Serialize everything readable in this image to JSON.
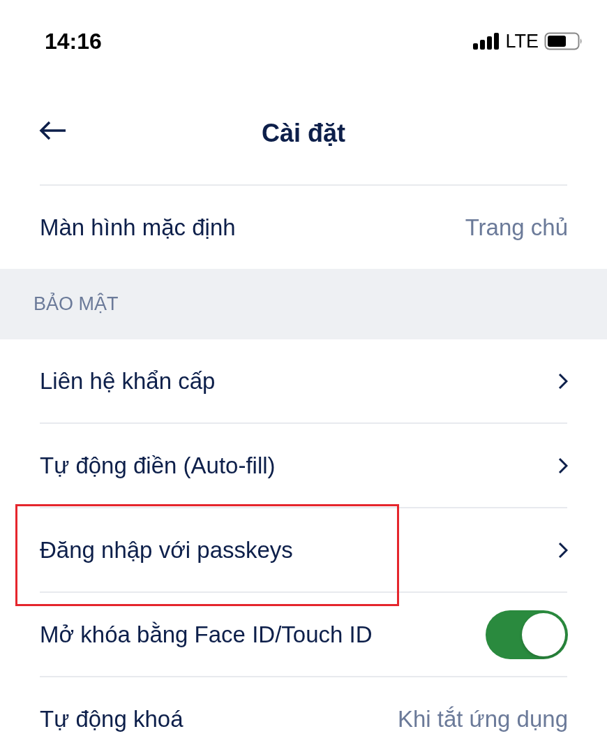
{
  "status_bar": {
    "time": "14:16",
    "network": "LTE"
  },
  "header": {
    "title": "Cài đặt"
  },
  "general_rows": [
    {
      "kind": "value",
      "label": "Màn hình mặc định",
      "value": "Trang chủ"
    }
  ],
  "section": {
    "title": "BẢO MẬT"
  },
  "security_rows": [
    {
      "kind": "link",
      "label": "Liên hệ khẩn cấp"
    },
    {
      "kind": "link",
      "label": "Tự động điền (Auto-fill)"
    },
    {
      "kind": "link",
      "label": "Đăng nhập với passkeys",
      "highlighted": true
    },
    {
      "kind": "toggle",
      "label": "Mở khóa bằng Face ID/Touch ID",
      "on": true
    },
    {
      "kind": "value",
      "label": "Tự động khoá",
      "value": "Khi tắt ứng dụng"
    }
  ]
}
